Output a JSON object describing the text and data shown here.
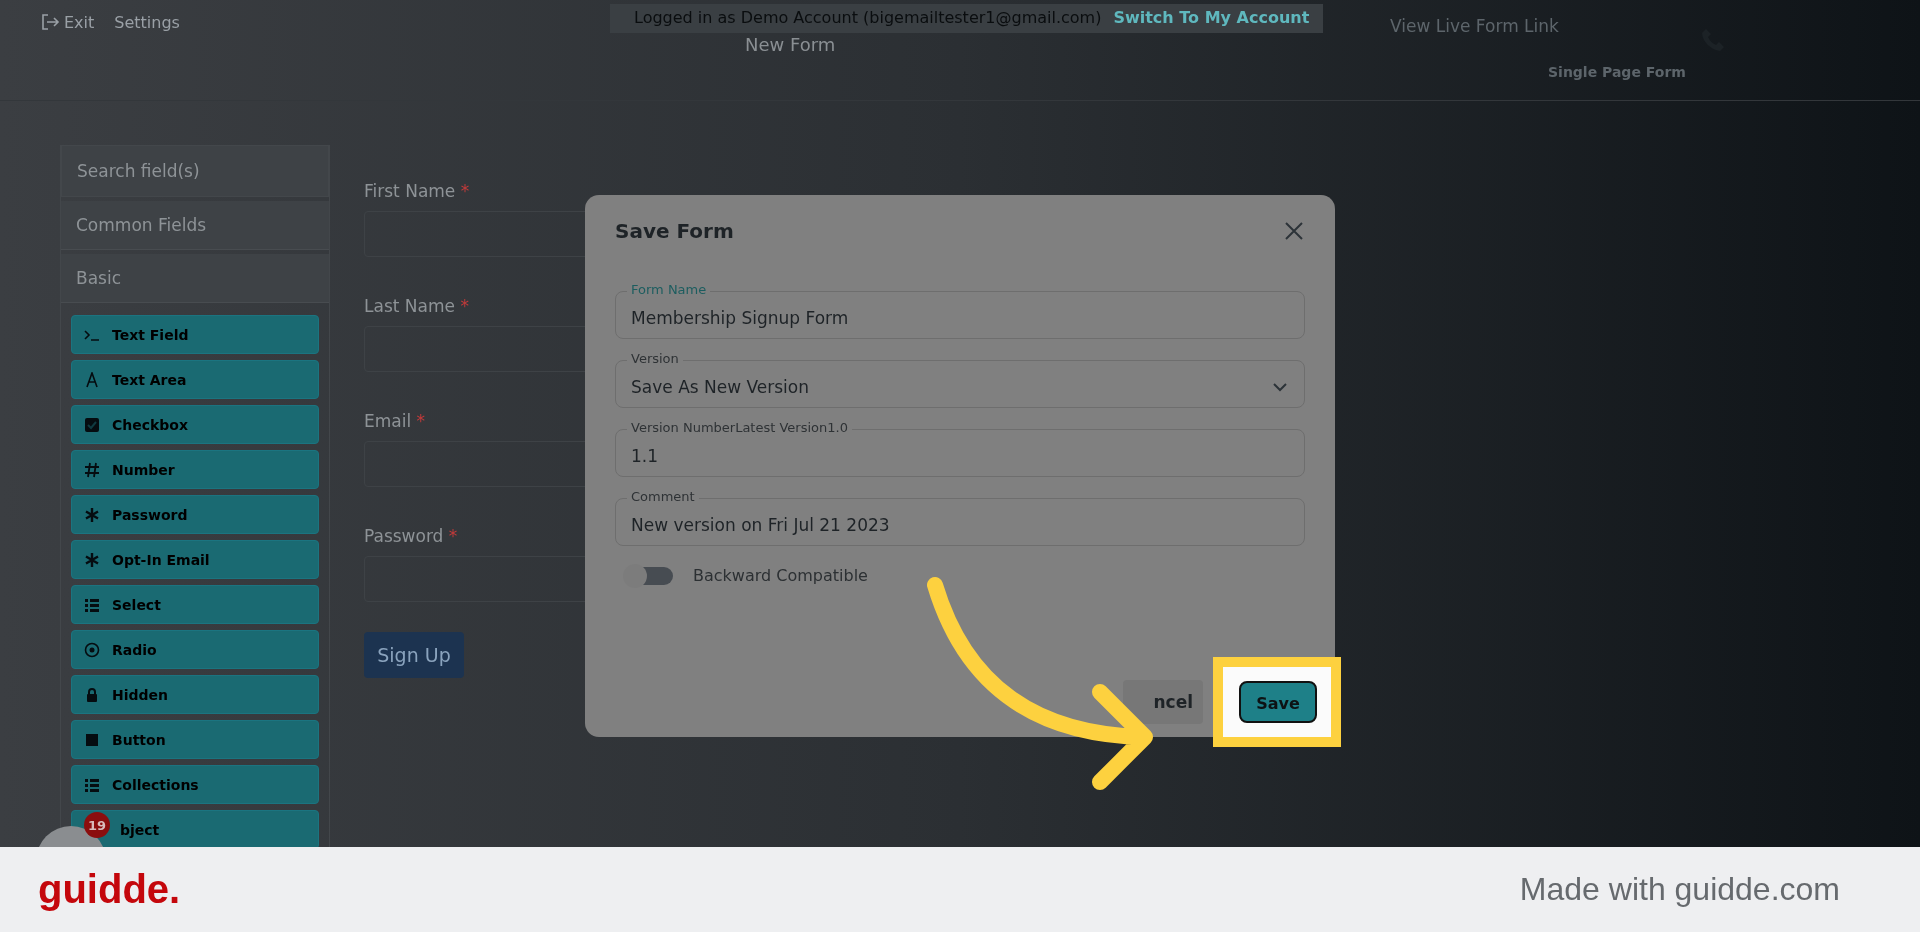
{
  "top_bar": {
    "exit": "Exit",
    "settings": "Settings",
    "page_title": "New Form",
    "banner": {
      "text": "Logged in as Demo Account (bigemailtester1@gmail.com)",
      "link": "Switch To My Account"
    },
    "live_link": "View Live Form Link",
    "form_type": "Single Page Form"
  },
  "sidebar": {
    "search": {
      "placeholder": "Search field(s)"
    },
    "sections": [
      "Common Fields",
      "Basic"
    ],
    "items": [
      {
        "label": "Text Field",
        "kind": "terminal"
      },
      {
        "label": "Text Area",
        "kind": "text"
      },
      {
        "label": "Checkbox",
        "kind": "checkbox"
      },
      {
        "label": "Number",
        "kind": "hash"
      },
      {
        "label": "Password",
        "kind": "asterisk"
      },
      {
        "label": "Opt-In Email",
        "kind": "asterisk"
      },
      {
        "label": "Select",
        "kind": "list"
      },
      {
        "label": "Radio",
        "kind": "radio"
      },
      {
        "label": "Hidden",
        "kind": "lock"
      },
      {
        "label": "Button",
        "kind": "square"
      },
      {
        "label": "Collections",
        "kind": "list"
      },
      {
        "label": "bject",
        "kind": "covered"
      }
    ]
  },
  "form": {
    "fields": [
      {
        "label": "First Name",
        "required_mark": "*"
      },
      {
        "label": "Last Name",
        "required_mark": "*"
      },
      {
        "label": "Email",
        "required_mark": "*"
      },
      {
        "label": "Password",
        "required_mark": "*"
      }
    ],
    "submit": "Sign Up"
  },
  "chat_badge": "19",
  "dialog": {
    "title": "Save Form",
    "fields": [
      {
        "label": "Form Name",
        "value": "Membership Signup Form",
        "kind": "text",
        "focused": true
      },
      {
        "label": "Version",
        "value": "Save As New Version",
        "kind": "select",
        "focused": false
      },
      {
        "label": "Version NumberLatest Version1.0",
        "value": "1.1",
        "kind": "text",
        "focused": false
      },
      {
        "label": "Comment",
        "value": "New version on Fri Jul 21 2023",
        "kind": "text",
        "focused": false
      }
    ],
    "toggle": {
      "label": "Backward Compatible",
      "on": false
    },
    "cancel": "ncel",
    "save": "Save"
  },
  "footer": {
    "logo": "guidde.",
    "tagline": "Made with guidde.com"
  }
}
